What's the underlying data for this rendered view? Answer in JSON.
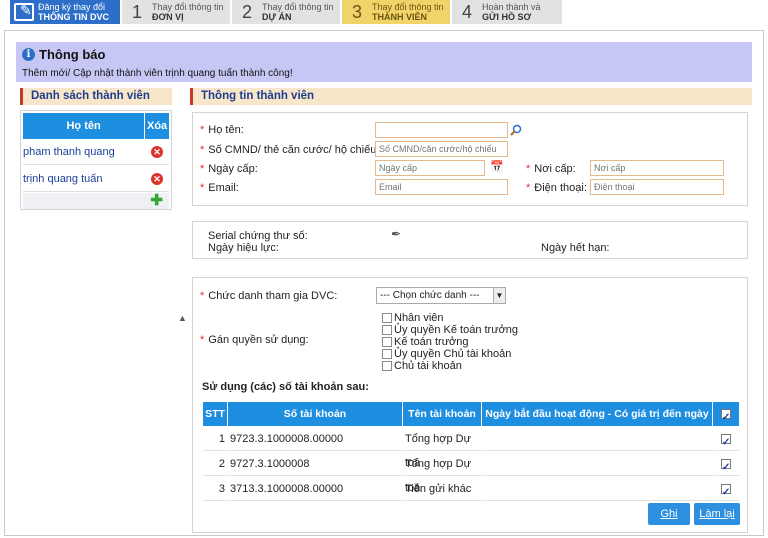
{
  "wizard": {
    "steps": [
      {
        "num": "",
        "line1": "Đăng ký thay đổi",
        "line2": "THÔNG TIN DVC"
      },
      {
        "num": "1",
        "line1": "Thay đổi thông tin",
        "line2": "ĐƠN VỊ"
      },
      {
        "num": "2",
        "line1": "Thay đổi thông tin",
        "line2": "DỰ ÁN"
      },
      {
        "num": "3",
        "line1": "Thay đổi thông tin",
        "line2": "THÀNH VIÊN"
      },
      {
        "num": "4",
        "line1": "Hoàn thành và",
        "line2": "GỬI HỒ SƠ"
      }
    ]
  },
  "notice": {
    "title": "Thông báo",
    "message": "Thêm mới/ Cập nhật thành viên trịnh quang tuấn thành công!"
  },
  "members": {
    "heading": "Danh sách thành viên",
    "col_name": "Họ tên",
    "col_delete": "Xóa",
    "rows": [
      {
        "name": "pham thanh quang"
      },
      {
        "name": "trịnh quang tuấn"
      }
    ]
  },
  "info": {
    "heading": "Thông tin thành viên",
    "fullname_label": "Họ tên:",
    "fullname_value": "",
    "id_label": "Số CMND/ thẻ căn cước/ hộ chiếu:",
    "id_placeholder": "Số CMND/căn cước/hộ chiếu",
    "issue_date_label": "Ngày cấp:",
    "issue_date_placeholder": "Ngày cấp",
    "issue_place_label": "Nơi cấp:",
    "issue_place_placeholder": "Nơi cấp",
    "email_label": "Email:",
    "email_placeholder": "Email",
    "phone_label": "Điện thoại:",
    "phone_placeholder": "Điện thoại"
  },
  "cert": {
    "serial_label": "Serial chứng thư số:",
    "valid_from_label": "Ngày hiệu lực:",
    "valid_to_label": "Ngày hết hạn:"
  },
  "roles": {
    "position_label": "Chức danh tham gia DVC:",
    "position_selected": "--- Chọn chức danh ---",
    "rights_label": "Gán quyền sử dụng:",
    "rights": [
      "Nhân viên",
      "Ủy quyền Kế toán trưởng",
      "Kế toán trưởng",
      "Ủy quyền Chủ tài khoản",
      "Chủ tài khoản"
    ]
  },
  "accounts": {
    "title": "Sử dụng (các) số tài khoản sau:",
    "col_stt": "STT",
    "col_number": "Số tài khoản",
    "col_name": "Tên tài khoản",
    "col_date": "Ngày bắt đầu hoạt động - Có giá trị đến ngày",
    "rows": [
      {
        "stt": "1",
        "number": "9723.3.1000008.00000",
        "name": "Tổng hợp Dự toá",
        "date": ""
      },
      {
        "stt": "2",
        "number": "9727.3.1000008",
        "name": "Tổng hợp Dự toá",
        "date": ""
      },
      {
        "stt": "3",
        "number": "3713.3.1000008.00000",
        "name": "Tiền gửi khác",
        "date": ""
      }
    ]
  },
  "buttons": {
    "save": "Ghi",
    "reset": "Làm lại"
  }
}
